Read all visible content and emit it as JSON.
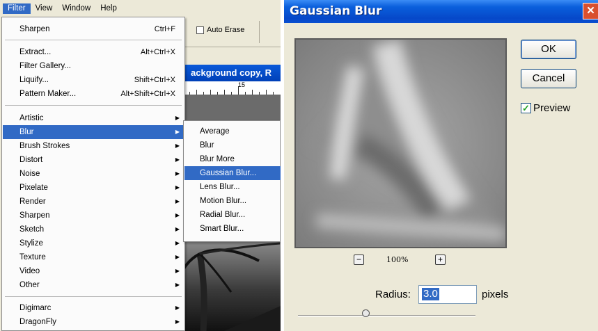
{
  "menubar": {
    "items": [
      "Filter",
      "View",
      "Window",
      "Help"
    ],
    "active_index": 0
  },
  "options_bar": {
    "auto_erase_label": "Auto Erase"
  },
  "document": {
    "title": "ackground copy, R",
    "ruler_label": "15"
  },
  "filter_menu": {
    "items": [
      {
        "label": "Sharpen",
        "shortcut": "Ctrl+F"
      },
      {
        "label": "Extract...",
        "shortcut": "Alt+Ctrl+X"
      },
      {
        "label": "Filter Gallery...",
        "shortcut": ""
      },
      {
        "label": "Liquify...",
        "shortcut": "Shift+Ctrl+X"
      },
      {
        "label": "Pattern Maker...",
        "shortcut": "Alt+Shift+Ctrl+X"
      },
      {
        "label": "Artistic",
        "submenu": true
      },
      {
        "label": "Blur",
        "submenu": true,
        "highlighted": true
      },
      {
        "label": "Brush Strokes",
        "submenu": true
      },
      {
        "label": "Distort",
        "submenu": true
      },
      {
        "label": "Noise",
        "submenu": true
      },
      {
        "label": "Pixelate",
        "submenu": true
      },
      {
        "label": "Render",
        "submenu": true
      },
      {
        "label": "Sharpen",
        "submenu": true
      },
      {
        "label": "Sketch",
        "submenu": true
      },
      {
        "label": "Stylize",
        "submenu": true
      },
      {
        "label": "Texture",
        "submenu": true
      },
      {
        "label": "Video",
        "submenu": true
      },
      {
        "label": "Other",
        "submenu": true
      },
      {
        "label": "Digimarc",
        "submenu": true
      },
      {
        "label": "DragonFly",
        "submenu": true
      }
    ]
  },
  "blur_submenu": {
    "items": [
      {
        "label": "Average"
      },
      {
        "label": "Blur"
      },
      {
        "label": "Blur More"
      },
      {
        "label": "Gaussian Blur...",
        "highlighted": true
      },
      {
        "label": "Lens Blur..."
      },
      {
        "label": "Motion Blur..."
      },
      {
        "label": "Radial Blur..."
      },
      {
        "label": "Smart Blur..."
      }
    ]
  },
  "dialog": {
    "title": "Gaussian Blur",
    "close_glyph": "✕",
    "ok_label": "OK",
    "cancel_label": "Cancel",
    "preview_label": "Preview",
    "preview_checked": true,
    "zoom_out_glyph": "−",
    "zoom_in_glyph": "+",
    "zoom_level": "100%",
    "radius_label": "Radius:",
    "radius_value": "3.0",
    "radius_unit": "pixels",
    "slider_icon": "slider-thumb-icon"
  },
  "colors": {
    "highlight": "#316ac5",
    "titlebar": "#0a5fdc",
    "dialog_bg": "#ece9d8"
  }
}
